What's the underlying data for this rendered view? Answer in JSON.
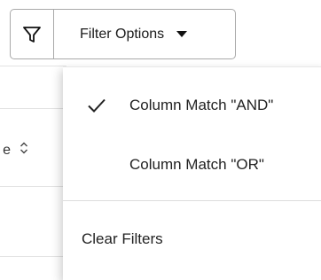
{
  "toolbar": {
    "filter_icon": "filter-funnel-icon",
    "filter_options_label": "Filter Options",
    "caret_icon": "caret-down-icon"
  },
  "table": {
    "partial_header_text": "e",
    "sort_icon": "sort-updown-icon"
  },
  "dropdown": {
    "items": [
      {
        "label": "Column Match \"AND\"",
        "checked": true
      },
      {
        "label": "Column Match \"OR\"",
        "checked": false
      }
    ],
    "clear_label": "Clear Filters",
    "check_icon": "checkmark-icon"
  },
  "colors": {
    "border": "#a9a9a9",
    "text": "#222222",
    "divider": "#dcdcdc"
  }
}
